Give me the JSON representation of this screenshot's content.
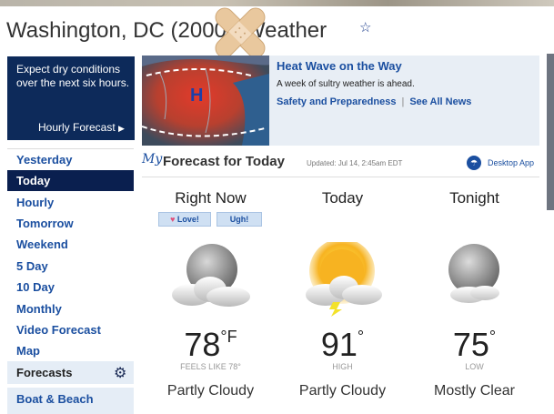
{
  "header": {
    "title_prefix": "Washington, DC (20",
    "title_zip_visible": "002)",
    "title_suffix": " Weather",
    "favorite_icon": "star-outline-icon"
  },
  "promo": {
    "text": "Expect dry conditions over the next six hours.",
    "link": "Hourly Forecast",
    "link_icon": "triangle-right-icon"
  },
  "nav": {
    "items": [
      {
        "label": "Yesterday"
      },
      {
        "label": "Today",
        "active": true
      },
      {
        "label": "Hourly"
      },
      {
        "label": "Tomorrow"
      },
      {
        "label": "Weekend"
      },
      {
        "label": "5 Day"
      },
      {
        "label": "10 Day"
      },
      {
        "label": "Monthly"
      },
      {
        "label": "Video Forecast"
      },
      {
        "label": "Map"
      }
    ],
    "forecasts_label": "Forecasts",
    "boat_label": "Boat & Beach"
  },
  "news": {
    "map_label": "H",
    "headline": "Heat Wave on the Way",
    "description": "A week of sultry weather is ahead.",
    "link1": "Safety and Preparedness",
    "link2": "See All News"
  },
  "forecast": {
    "my_label": "My",
    "title": "Forecast for Today",
    "updated": "Updated: Jul 14, 2:45am EDT",
    "desktop_app": "Desktop App",
    "love": "Love!",
    "ugh": "Ugh!",
    "columns": [
      {
        "title": "Right Now",
        "temp": "78",
        "unit": "°F",
        "sub": "FEELS LIKE 78°",
        "condition": "Partly Cloudy",
        "icon": "partly-cloudy-night-icon"
      },
      {
        "title": "Today",
        "temp": "91",
        "unit": "°",
        "sub": "HIGH",
        "condition": "Partly Cloudy",
        "icon": "partly-cloudy-day-icon"
      },
      {
        "title": "Tonight",
        "temp": "75",
        "unit": "°",
        "sub": "LOW",
        "condition": "Mostly Clear",
        "icon": "mostly-clear-night-icon"
      }
    ]
  }
}
